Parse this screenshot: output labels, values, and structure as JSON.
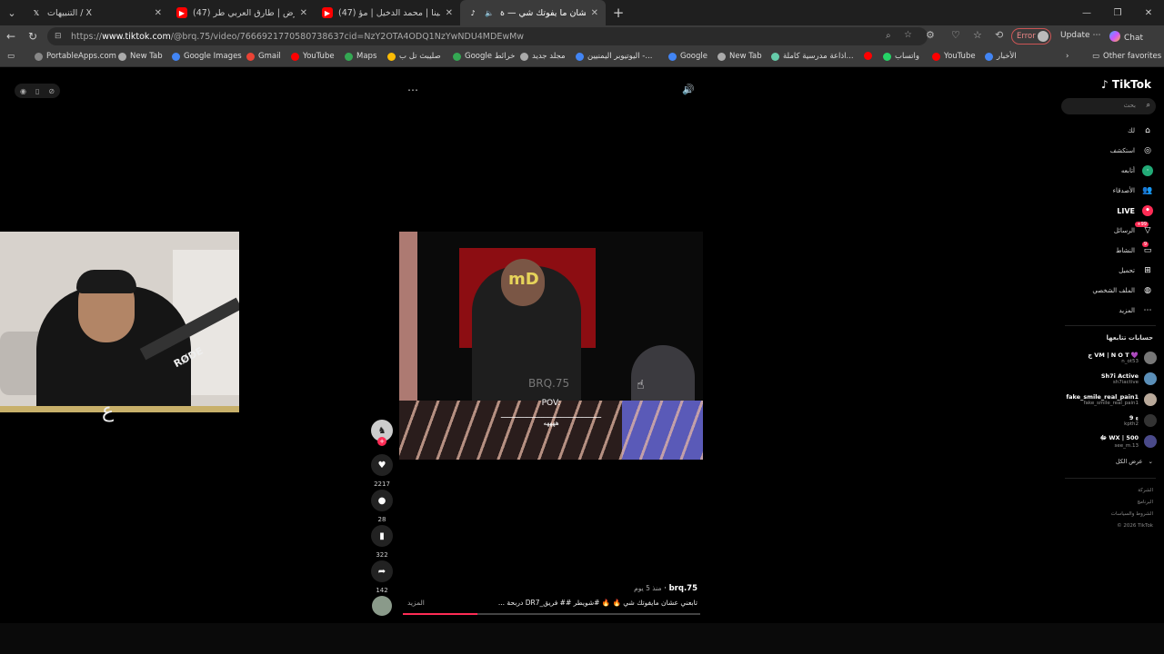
{
  "browser": {
    "tabs": [
      {
        "title": "التنبيهات / X",
        "icon": "x-logo-icon",
        "active": false
      },
      {
        "title": "(47) صقور الارض | طارق العربي طر…",
        "icon": "youtube-icon",
        "active": false
      },
      {
        "title": "(47) شيلة مشينا | محمد الدخيل | مؤ…",
        "icon": "youtube-icon",
        "active": false
      },
      {
        "title": "تابعني عشان ما يفوتك شي — ة…",
        "icon": "tiktok-icon",
        "active": true
      }
    ],
    "url_prefix": "https://",
    "url_domain": "www.tiktok.com",
    "url_path": "/@brq.75/video/7666921770580738637cid=NzY2OTA4ODQ1NzYwNDU4MDEwMw",
    "error_label": "Error",
    "update_label": "Update",
    "chat_label": "Chat",
    "bookmarks": [
      {
        "label": "PortableApps.com",
        "color": "#888888"
      },
      {
        "label": "New Tab",
        "color": "#aaaaaa"
      },
      {
        "label": "Google Images",
        "color": "#4285f4"
      },
      {
        "label": "Gmail",
        "color": "#ea4335"
      },
      {
        "label": "YouTube",
        "color": "#ff0000"
      },
      {
        "label": "Maps",
        "color": "#34a853"
      },
      {
        "label": "صليبث تل ب",
        "color": "#fbbc05"
      },
      {
        "label": "Google خرائط",
        "color": "#34a853"
      },
      {
        "label": "مجلد جديد",
        "color": "#aaaaaa"
      },
      {
        "label": "اليوتيوبر اليمنيين -...",
        "color": "#4285f4"
      },
      {
        "label": "Google",
        "color": "#4285f4"
      },
      {
        "label": "New Tab",
        "color": "#aaaaaa"
      },
      {
        "label": "اذاعة مدرسية كاملة...",
        "color": "#66ccaa"
      },
      {
        "label": "",
        "color": "#ff0000"
      },
      {
        "label": "واتساب",
        "color": "#25d366"
      },
      {
        "label": "YouTube",
        "color": "#ff0000"
      },
      {
        "label": "الأخبار",
        "color": "#4285f4"
      }
    ],
    "other_favorites": "Other favorites"
  },
  "video": {
    "watermark": "BRQ.75",
    "pov": "POV:",
    "overlay_text": "ـــــــــــــــــــــــــــــــــــــــــــــــ",
    "overlay_text2": "ههههه",
    "progress": 0.25
  },
  "actions": {
    "likes": "2217",
    "comments": "28",
    "saves": "322",
    "shares": "142"
  },
  "meta": {
    "username": "brq.75",
    "time": "منذ 5 يوم",
    "caption": "تابعني عشان مايفوتك شي 🔥 🔥 #شويطر ## فريق_DR7 دربحة ...",
    "more": "المزيد"
  },
  "sidebar": {
    "logo": "TikTok",
    "search_placeholder": "بحث",
    "menu": [
      {
        "label": "لك",
        "icon": "home-icon",
        "bold": false
      },
      {
        "label": "استكشف",
        "icon": "compass-icon",
        "bold": false
      },
      {
        "label": "أتابعه",
        "icon": "following-icon",
        "bold": false
      },
      {
        "label": "الأصدقاء",
        "icon": "friends-icon",
        "bold": false
      },
      {
        "label": "LIVE",
        "icon": "live-icon",
        "bold": true
      },
      {
        "label": "الرسائل",
        "icon": "messages-icon",
        "bold": false
      },
      {
        "label": "النشاط",
        "icon": "activity-icon",
        "bold": false
      },
      {
        "label": "تحميل",
        "icon": "upload-icon",
        "bold": false
      },
      {
        "label": "الملف الشخصي",
        "icon": "profile-icon",
        "bold": false
      },
      {
        "label": "المزيد",
        "icon": "more-icon",
        "bold": false
      }
    ],
    "messages_badge": "99+",
    "activity_badge": "9",
    "following_title": "حسابات تتابعها",
    "following": [
      {
        "name": "ج VM | N O T 💜",
        "handle": "n_ot53",
        "color": "#777777"
      },
      {
        "name": "Sh7i Active",
        "handle": "sh7iactive",
        "color": "#5b8fb8"
      },
      {
        "name": "fake_smile_real_pain1",
        "handle": "fake_smile_real_pain1",
        "color": "#b9a99a"
      },
      {
        "name": "9 ءِ",
        "handle": "kpth2",
        "color": "#333333"
      },
      {
        "name": "ﷻ WX | 500",
        "handle": "see_m.13",
        "color": "#4a4a8a"
      }
    ],
    "see_all": "عرض الكل",
    "footer": [
      "الشركة",
      "البرنامج",
      "الشروط والسياسات",
      "© 2026 TikTok"
    ]
  }
}
